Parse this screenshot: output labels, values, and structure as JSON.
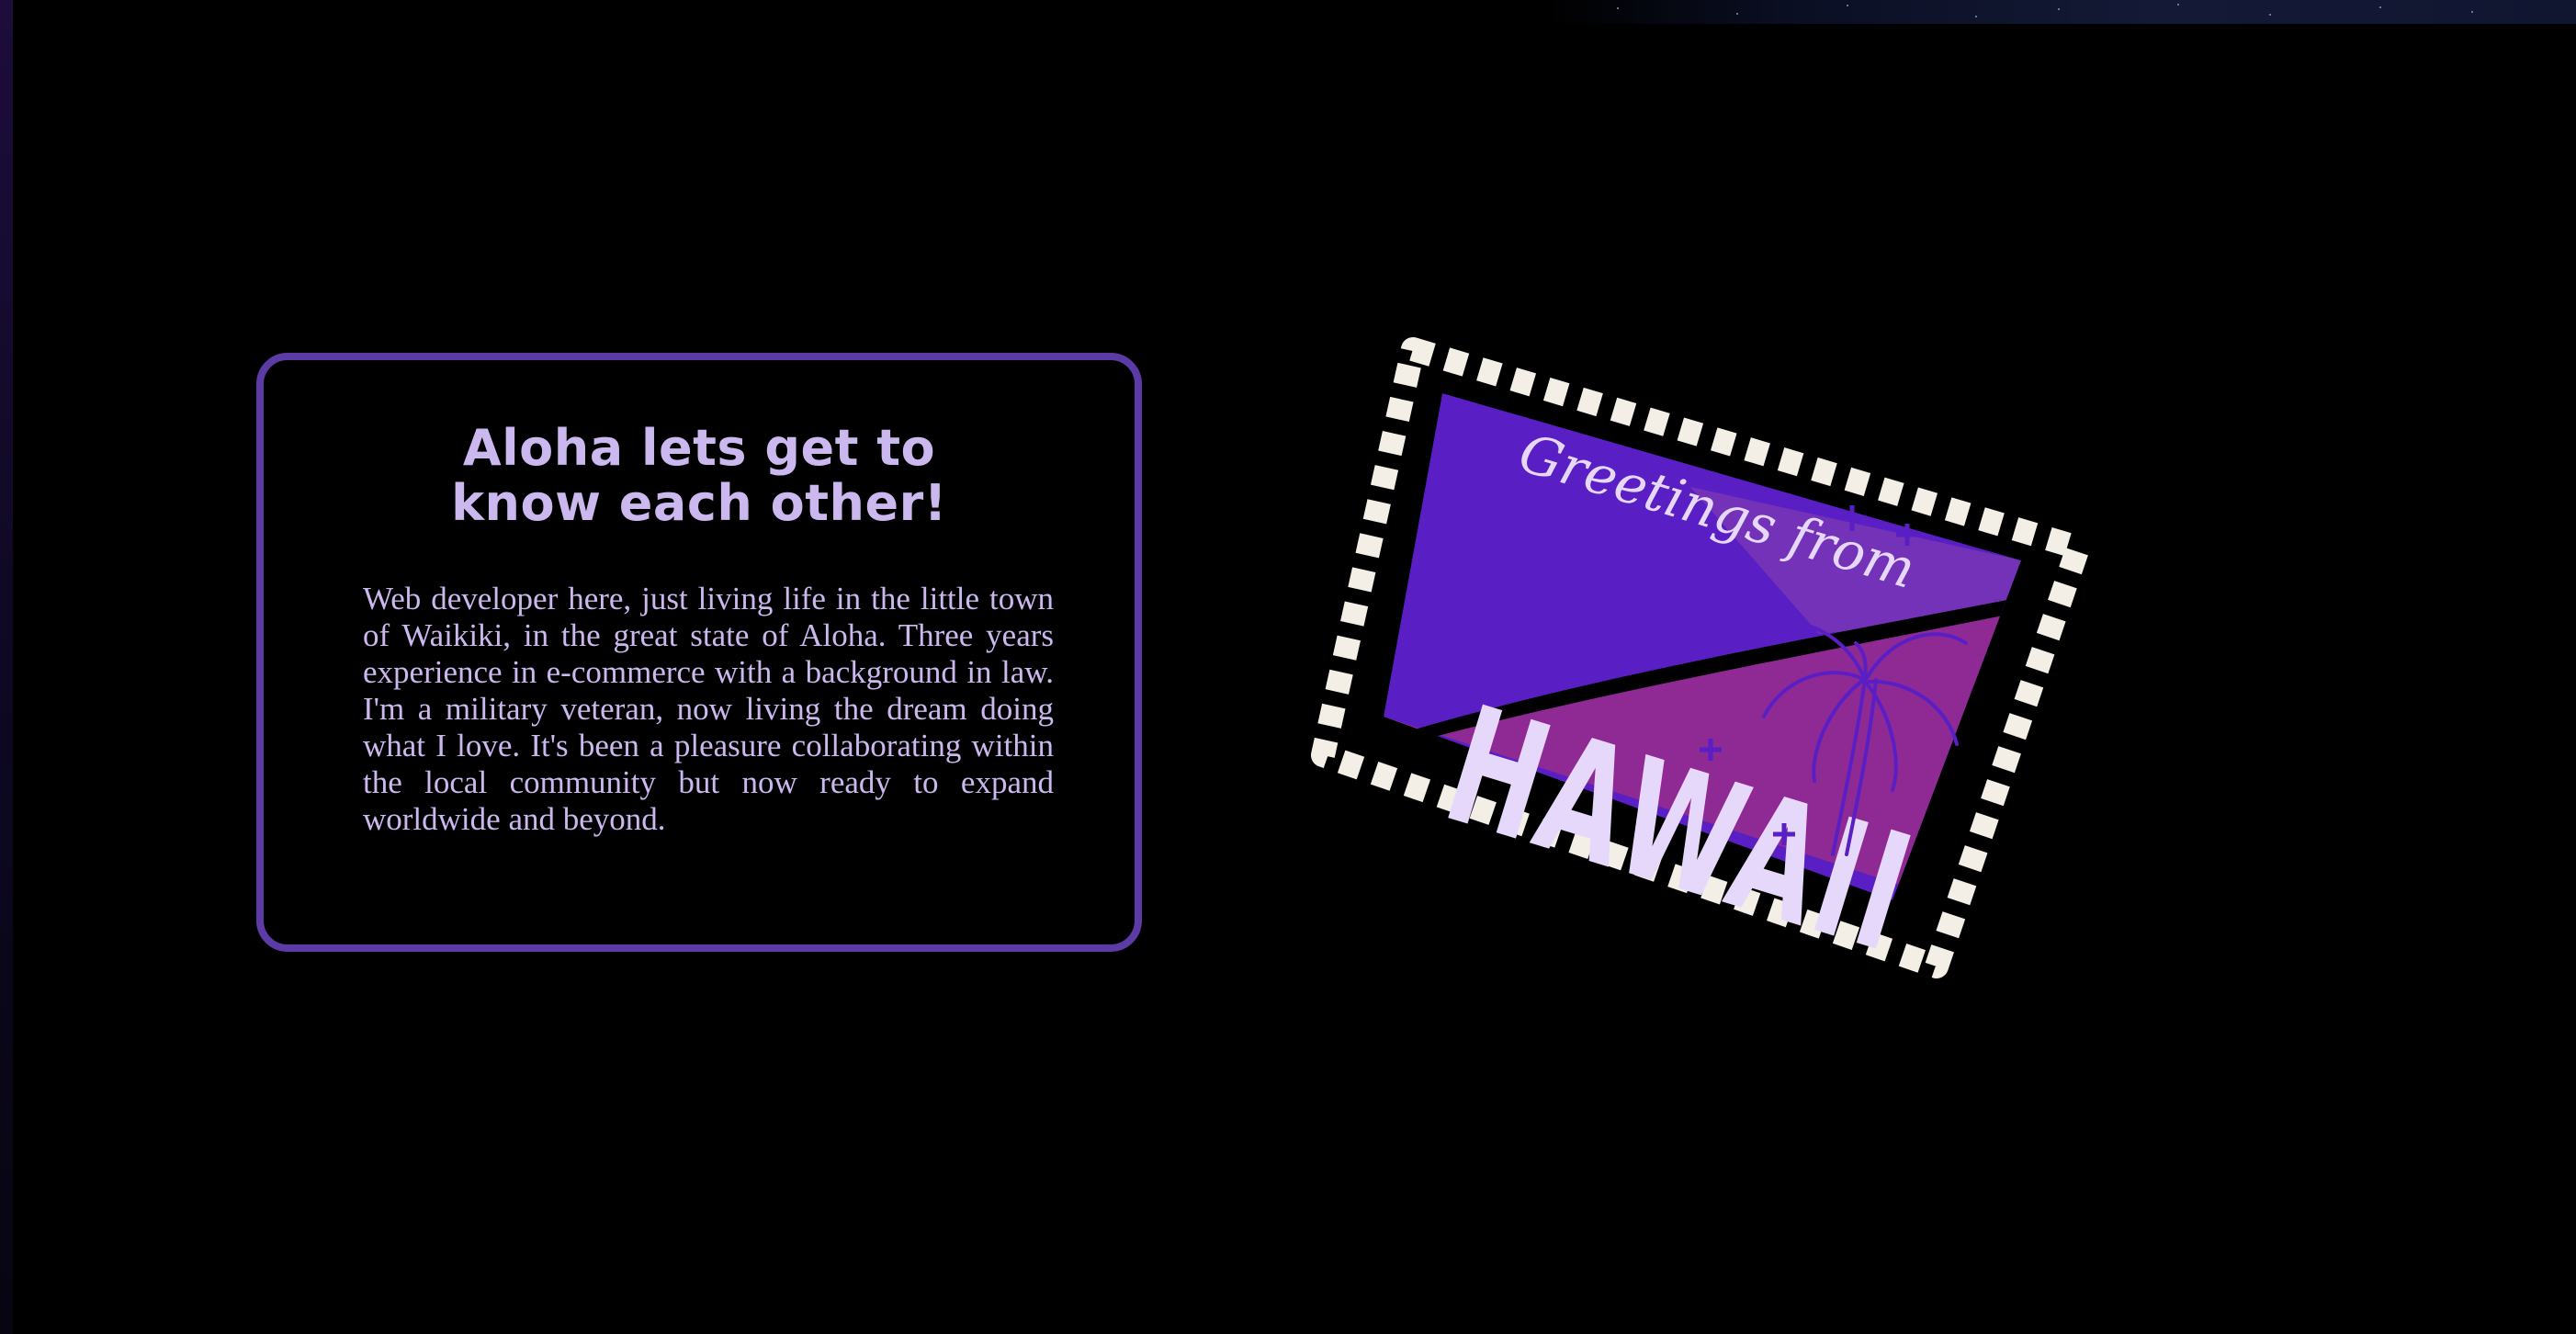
{
  "about": {
    "title": "Aloha lets get to\nknow each other!",
    "body": "Web developer here, just living life in the little town of Waikiki, in the great state of Aloha. Three years experience in e-commerce with a background in law. I'm a military veteran, now living the dream doing what I love. It's been a pleasure collaborating within the local community but now ready to expand worldwide and beyond."
  },
  "stamp": {
    "script_text": "Greetings from",
    "big_text": "HAWAII",
    "icon": "palm-tree-icon"
  },
  "colors": {
    "background": "#000000",
    "card_border": "#5c3ba6",
    "text": "#cbb8ef",
    "stamp_purple": "#5a1fc4",
    "stamp_magenta": "#8f2a94",
    "stamp_lettering": "#e6d8fb"
  }
}
